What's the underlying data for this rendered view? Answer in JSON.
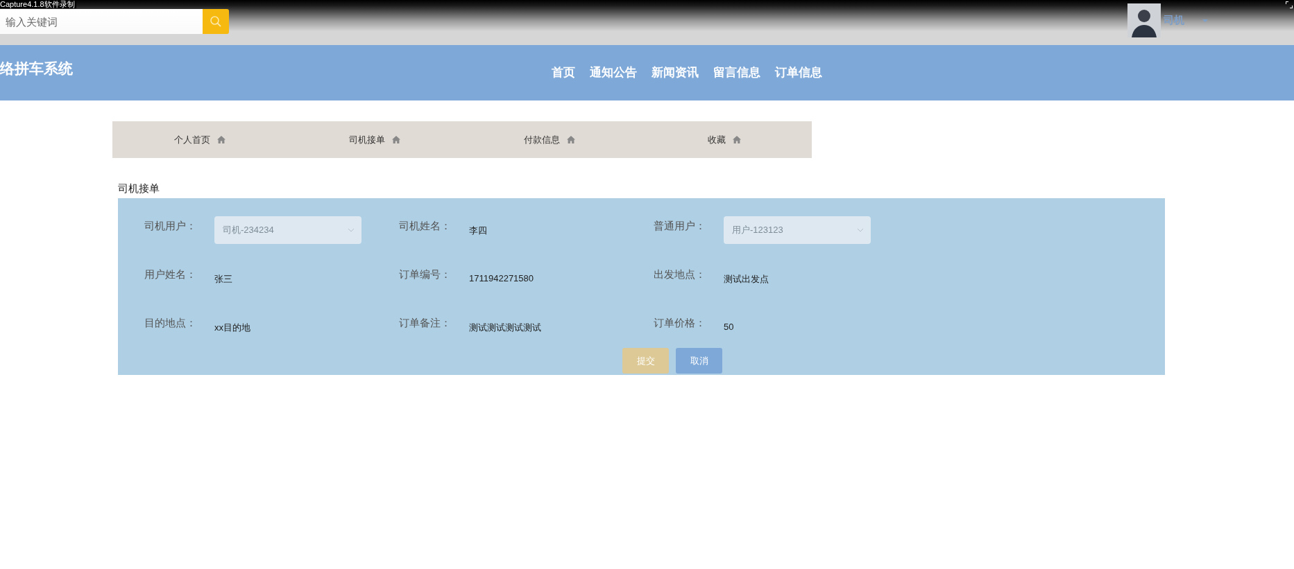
{
  "recorder_label": "Capture4.1.8软件录制",
  "search": {
    "placeholder": "输入关键词"
  },
  "user": {
    "name": "司机"
  },
  "site_title": "络拼车系统",
  "nav": [
    "首页",
    "通知公告",
    "新闻资讯",
    "留言信息",
    "订单信息"
  ],
  "sub_tabs": [
    "个人首页",
    "司机接单",
    "付款信息",
    "收藏"
  ],
  "form": {
    "title": "司机接单",
    "fields": [
      {
        "label": "司机用户：",
        "kind": "select",
        "value": "司机-234234",
        "disabled": true
      },
      {
        "label": "司机姓名：",
        "kind": "text",
        "value": "李四"
      },
      {
        "label": "普通用户：",
        "kind": "select",
        "value": "用户-123123",
        "disabled": true
      },
      {
        "label": "用户姓名：",
        "kind": "text",
        "value": "张三"
      },
      {
        "label": "订单编号：",
        "kind": "text",
        "value": "1711942271580"
      },
      {
        "label": "出发地点：",
        "kind": "text",
        "value": "测试出发点"
      },
      {
        "label": "目的地点：",
        "kind": "text",
        "value": "xx目的地"
      },
      {
        "label": "订单备注：",
        "kind": "text",
        "value": "测试测试测试测试"
      },
      {
        "label": "订单价格：",
        "kind": "text",
        "value": "50"
      }
    ],
    "buttons": [
      {
        "label": "提交",
        "kind": "submit"
      },
      {
        "label": "取消",
        "kind": "cancel"
      }
    ]
  }
}
